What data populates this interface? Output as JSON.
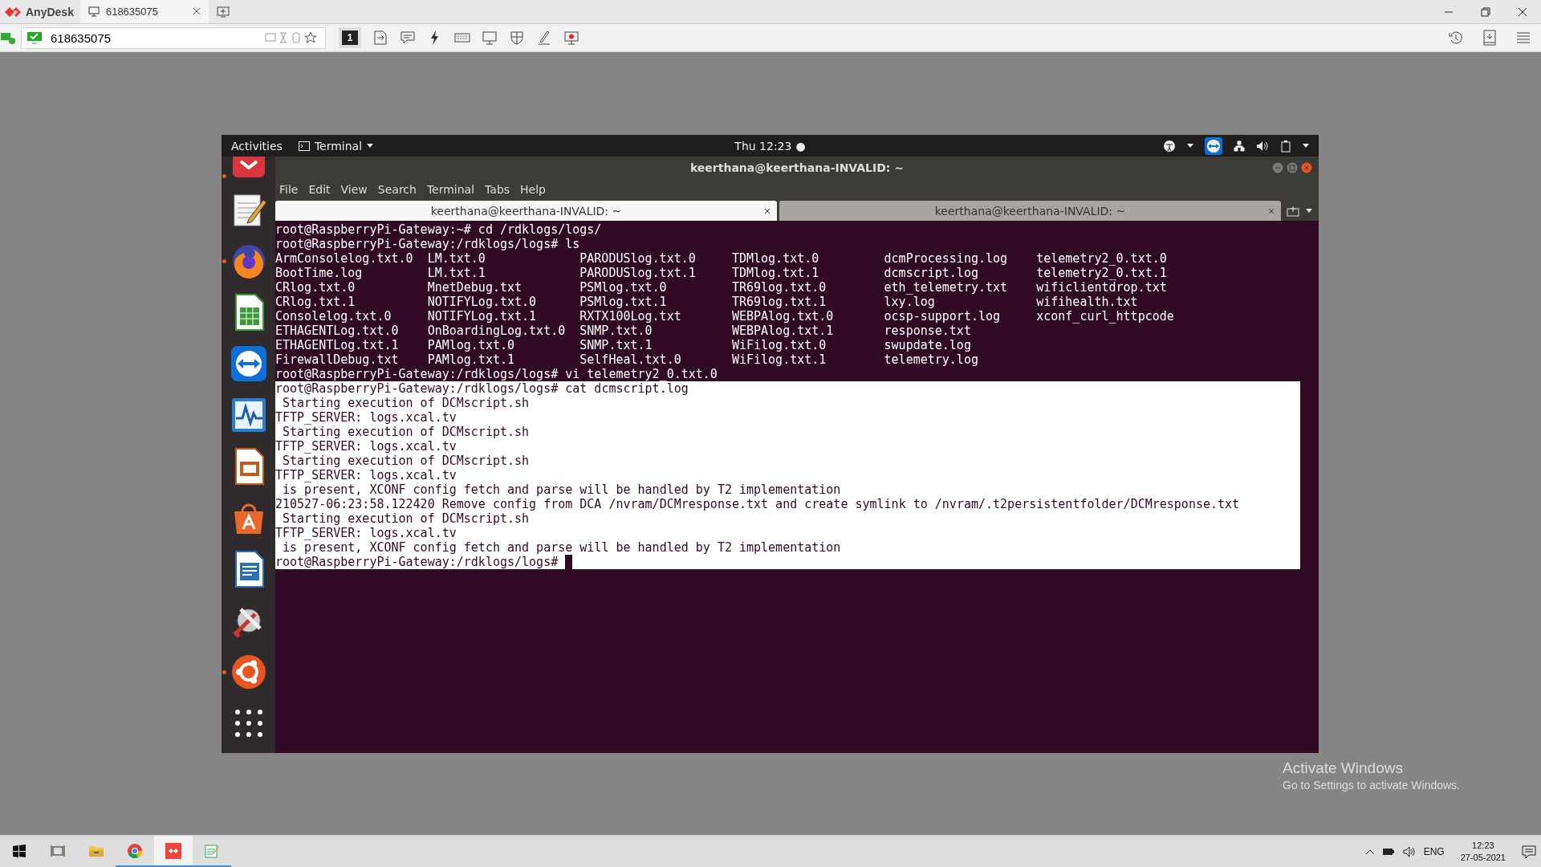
{
  "anydesk": {
    "app_name": "AnyDesk",
    "tabs": [
      {
        "label": "618635075",
        "selected": true
      }
    ],
    "address": "618635075",
    "display_number": "1"
  },
  "remote": {
    "topbar": {
      "activities": "Activities",
      "app_menu": "Terminal",
      "clock": "Thu 12:23",
      "notification_dot": "●"
    },
    "dock": [
      {
        "kind": "anydesk",
        "running": true
      },
      {
        "kind": "text-editor",
        "running": false
      },
      {
        "kind": "firefox",
        "running": true
      },
      {
        "kind": "spreadsheet",
        "running": false
      },
      {
        "kind": "teamviewer",
        "running": false
      },
      {
        "kind": "system-monitor",
        "running": false
      },
      {
        "kind": "presentation",
        "running": false
      },
      {
        "kind": "software",
        "running": false
      },
      {
        "kind": "writer",
        "running": false
      },
      {
        "kind": "tools",
        "running": false
      },
      {
        "kind": "ubuntu",
        "running": true
      },
      {
        "kind": "app-grid",
        "running": false
      }
    ],
    "terminal": {
      "title": "keerthana@keerthana-INVALID: ~",
      "menu": [
        "File",
        "Edit",
        "View",
        "Search",
        "Terminal",
        "Tabs",
        "Help"
      ],
      "tabs": [
        {
          "label": "keerthana@keerthana-INVALID: ~",
          "selected": true
        },
        {
          "label": "keerthana@keerthana-INVALID: ~",
          "selected": false
        }
      ],
      "output": [
        {
          "kind": "line",
          "text": "root@RaspberryPi-Gateway:~# cd /rdklogs/logs/",
          "highlighted": false,
          "cursor": false
        },
        {
          "kind": "line",
          "text": "root@RaspberryPi-Gateway:/rdklogs/logs# ls",
          "highlighted": false,
          "cursor": false
        },
        {
          "kind": "ls_row",
          "cells": [
            "ArmConsolelog.txt.0",
            "LM.txt.0",
            "PARODUSlog.txt.0",
            "TDMlog.txt.0",
            "dcmProcessing.log",
            "telemetry2_0.txt.0"
          ]
        },
        {
          "kind": "ls_row",
          "cells": [
            "BootTime.log",
            "LM.txt.1",
            "PARODUSlog.txt.1",
            "TDMlog.txt.1",
            "dcmscript.log",
            "telemetry2_0.txt.1"
          ]
        },
        {
          "kind": "ls_row",
          "cells": [
            "CRlog.txt.0",
            "MnetDebug.txt",
            "PSMlog.txt.0",
            "TR69log.txt.0",
            "eth_telemetry.txt",
            "wificlientdrop.txt"
          ]
        },
        {
          "kind": "ls_row",
          "cells": [
            "CRlog.txt.1",
            "NOTIFYLog.txt.0",
            "PSMlog.txt.1",
            "TR69log.txt.1",
            "lxy.log",
            "wifihealth.txt"
          ]
        },
        {
          "kind": "ls_row",
          "cells": [
            "Consolelog.txt.0",
            "NOTIFYLog.txt.1",
            "RXTX100Log.txt",
            "WEBPAlog.txt.0",
            "ocsp-support.log",
            "xconf_curl_httpcode"
          ]
        },
        {
          "kind": "ls_row",
          "cells": [
            "ETHAGENTLog.txt.0",
            "OnBoardingLog.txt.0",
            "SNMP.txt.0",
            "WEBPAlog.txt.1",
            "response.txt"
          ]
        },
        {
          "kind": "ls_row",
          "cells": [
            "ETHAGENTLog.txt.1",
            "PAMlog.txt.0",
            "SNMP.txt.1",
            "WiFilog.txt.0",
            "swupdate.log"
          ]
        },
        {
          "kind": "ls_row",
          "cells": [
            "FirewallDebug.txt",
            "PAMlog.txt.1",
            "SelfHeal.txt.0",
            "WiFilog.txt.1",
            "telemetry.log"
          ]
        },
        {
          "kind": "line",
          "text": "root@RaspberryPi-Gateway:/rdklogs/logs# vi telemetry2_0.txt.0",
          "highlighted": false,
          "cursor": false
        },
        {
          "kind": "line",
          "text": "root@RaspberryPi-Gateway:/rdklogs/logs# cat dcmscript.log",
          "highlighted": true,
          "cursor": false
        },
        {
          "kind": "line",
          "text": " Starting execution of DCMscript.sh",
          "highlighted": true,
          "cursor": false
        },
        {
          "kind": "line",
          "text": "TFTP_SERVER: logs.xcal.tv",
          "highlighted": true,
          "cursor": false
        },
        {
          "kind": "line",
          "text": " Starting execution of DCMscript.sh",
          "highlighted": true,
          "cursor": false
        },
        {
          "kind": "line",
          "text": "TFTP_SERVER: logs.xcal.tv",
          "highlighted": true,
          "cursor": false
        },
        {
          "kind": "line",
          "text": " Starting execution of DCMscript.sh",
          "highlighted": true,
          "cursor": false
        },
        {
          "kind": "line",
          "text": "TFTP_SERVER: logs.xcal.tv",
          "highlighted": true,
          "cursor": false
        },
        {
          "kind": "line",
          "text": " is present, XCONF config fetch and parse will be handled by T2 implementation",
          "highlighted": true,
          "cursor": false
        },
        {
          "kind": "line",
          "text": "210527-06:23:58.122420 Remove config from DCA /nvram/DCMresponse.txt and create symlink to /nvram/.t2persistentfolder/DCMresponse.txt",
          "highlighted": true,
          "cursor": false
        },
        {
          "kind": "line",
          "text": " Starting execution of DCMscript.sh",
          "highlighted": true,
          "cursor": false
        },
        {
          "kind": "line",
          "text": "TFTP_SERVER: logs.xcal.tv",
          "highlighted": true,
          "cursor": false
        },
        {
          "kind": "line",
          "text": " is present, XCONF config fetch and parse will be handled by T2 implementation",
          "highlighted": true,
          "cursor": false
        },
        {
          "kind": "line",
          "text": "root@RaspberryPi-Gateway:/rdklogs/logs#",
          "highlighted": true,
          "cursor": true
        }
      ]
    }
  },
  "activation_notice": {
    "title": "Activate Windows",
    "subtitle": "Go to Settings to activate Windows."
  },
  "taskbar": {
    "apps": [
      {
        "kind": "task-view",
        "running": false,
        "active": false
      },
      {
        "kind": "file-explorer",
        "running": false,
        "active": false
      },
      {
        "kind": "chrome",
        "running": true,
        "active": false
      },
      {
        "kind": "anydesk",
        "running": true,
        "active": true
      },
      {
        "kind": "notepad",
        "running": true,
        "active": false
      }
    ],
    "language": "ENG",
    "time": "12:23",
    "date": "27-05-2021"
  }
}
